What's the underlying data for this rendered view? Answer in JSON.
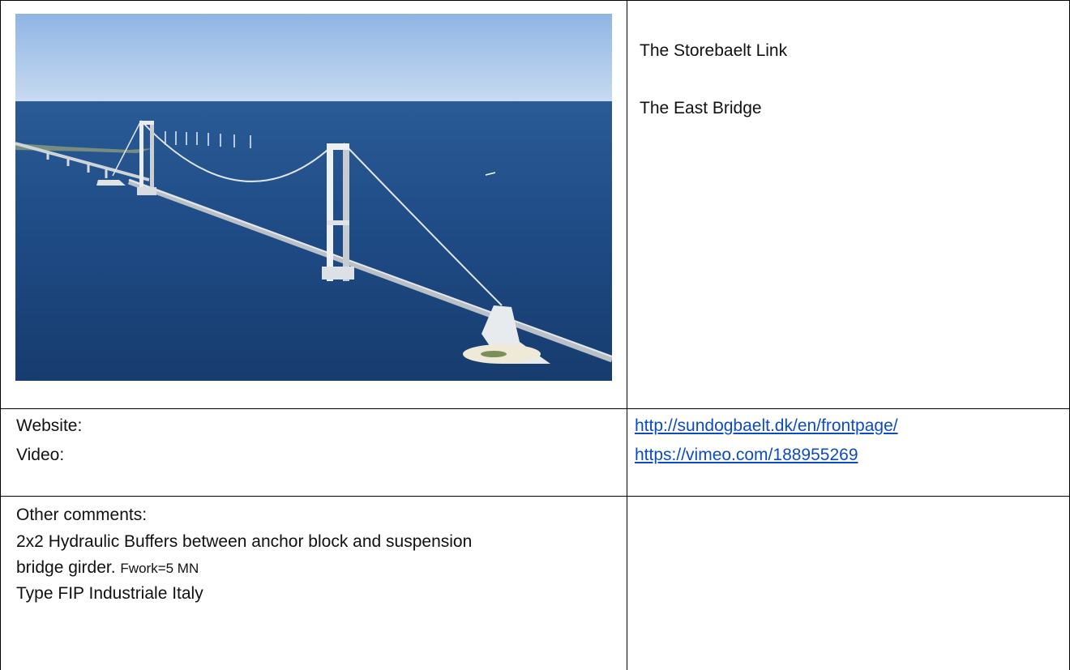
{
  "header_cell": {
    "title": "The Storebaelt Link",
    "subtitle": "The East Bridge"
  },
  "links_cell": {
    "website_label": "Website:",
    "video_label": "Video:",
    "website_url": "http://sundogbaelt.dk/en/frontpage/",
    "video_url": "https://vimeo.com/188955269"
  },
  "comments_cell": {
    "heading": "Other comments:",
    "line1": "2x2 Hydraulic Buffers between anchor block and suspension",
    "line2_start": "bridge girder. ",
    "line2_small": "Fwork=5 MN",
    "line3": "Type FIP Industriale Italy"
  },
  "photo": {
    "subject": "suspension-bridge-over-sea",
    "sky_color": "#a9c9ec",
    "sea_color": "#1e4a84"
  }
}
